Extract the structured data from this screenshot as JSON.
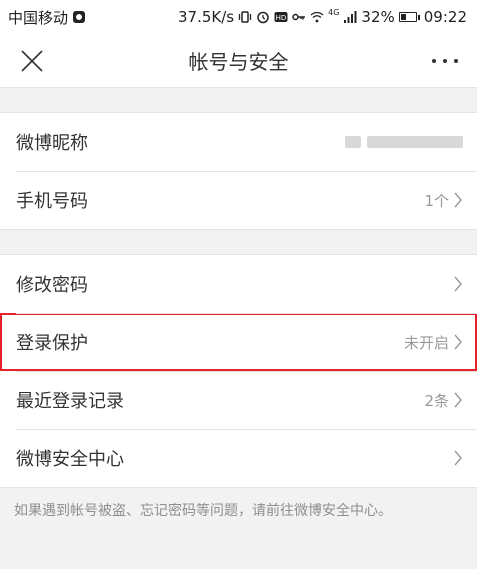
{
  "status_bar": {
    "carrier": "中国移动",
    "speed": "37.5K/s",
    "network": "4G",
    "battery": "32%",
    "battery_level": 0.32,
    "time": "09:22"
  },
  "nav": {
    "title": "帐号与安全",
    "more": "···"
  },
  "groups": [
    {
      "rows": [
        {
          "label": "微博昵称",
          "value": ""
        },
        {
          "label": "手机号码",
          "value": "1个"
        }
      ]
    },
    {
      "rows": [
        {
          "label": "修改密码",
          "value": ""
        },
        {
          "label": "登录保护",
          "value": "未开启"
        },
        {
          "label": "最近登录记录",
          "value": "2条"
        },
        {
          "label": "微博安全中心",
          "value": ""
        }
      ]
    }
  ],
  "footer": {
    "note": "如果遇到帐号被盗、忘记密码等问题，请前往微博安全中心。"
  },
  "colors": {
    "highlight": "#e8202a",
    "background": "#f2f2f2",
    "secondary_text": "#999999"
  }
}
